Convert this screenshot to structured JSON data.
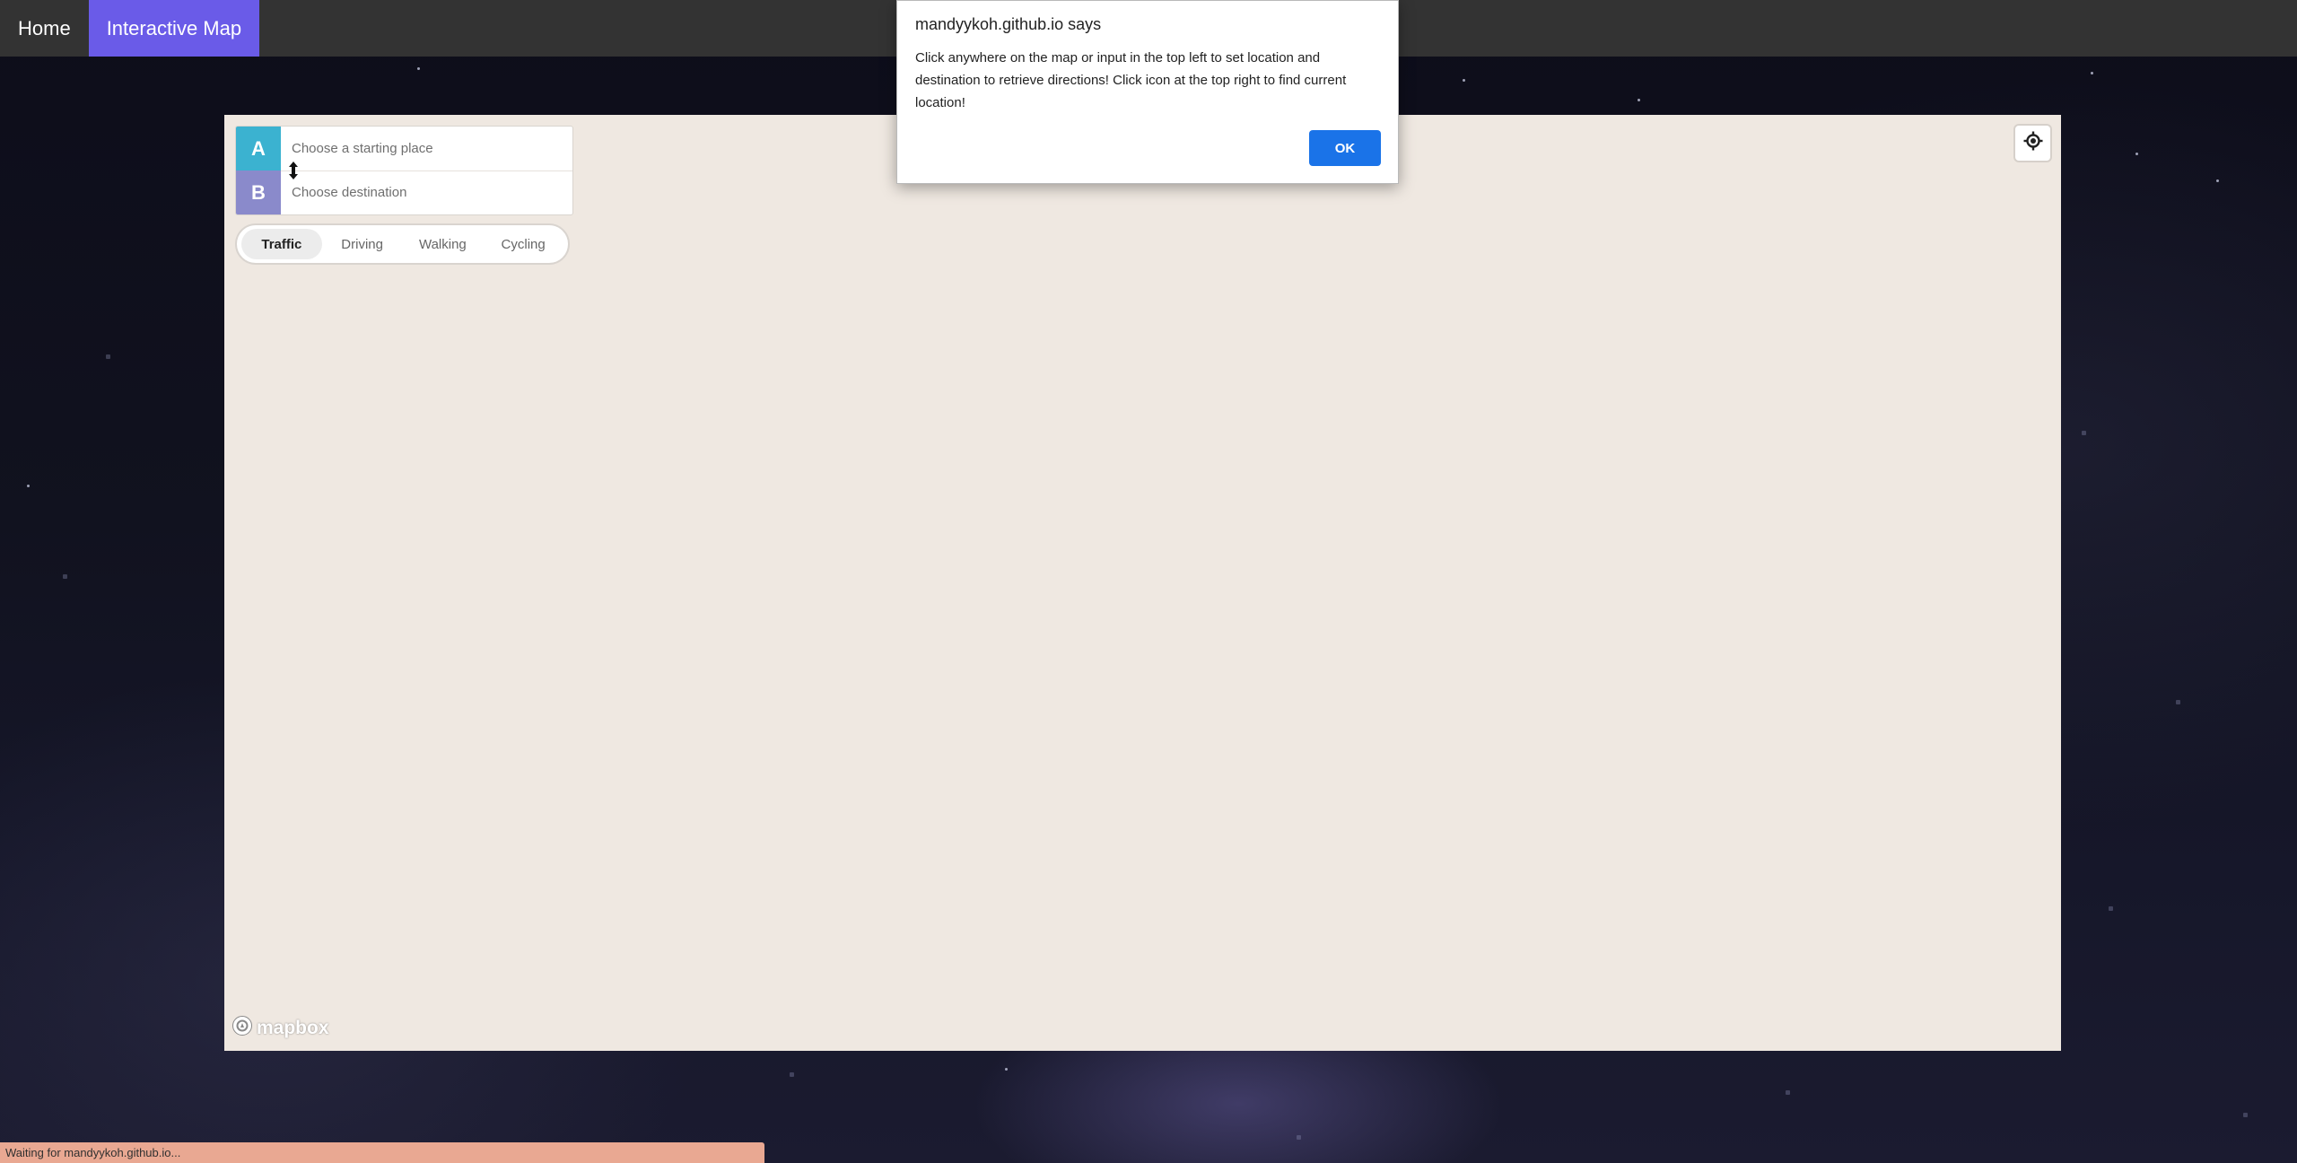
{
  "nav": {
    "items": [
      {
        "label": "Home",
        "active": false
      },
      {
        "label": "Interactive Map",
        "active": true
      }
    ],
    "active_color": "#6a5be8"
  },
  "directions": {
    "origin": {
      "tag": "A",
      "placeholder": "Choose a starting place",
      "value": ""
    },
    "destination": {
      "tag": "B",
      "placeholder": "Choose destination",
      "value": ""
    },
    "origin_color": "#3bb2d0",
    "destination_color": "#8a8acb",
    "reverse_icon": "swap-vertical-icon",
    "profiles": [
      "Traffic",
      "Driving",
      "Walking",
      "Cycling"
    ],
    "active_profile": "Traffic"
  },
  "map": {
    "background": "#efe8e1",
    "locate_icon": "geolocate-icon",
    "logo_text": "mapbox"
  },
  "dialog": {
    "title": "mandyykoh.github.io says",
    "message": "Click anywhere on the map or input in the top left to set location and destination to retrieve directions! Click icon at the top right to find current location!",
    "ok_label": "OK"
  },
  "status": {
    "text": "Waiting for mandyykoh.github.io..."
  }
}
